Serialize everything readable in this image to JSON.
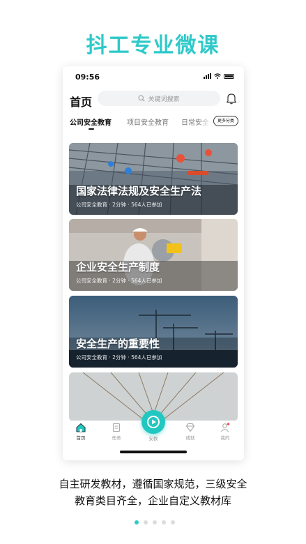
{
  "headline": "抖工专业微课",
  "status_bar": {
    "time": "09:56"
  },
  "header": {
    "title": "首页",
    "search_placeholder": "关键词搜索"
  },
  "tabs": [
    {
      "label": "公司安全教育",
      "active": true
    },
    {
      "label": "项目安全教育",
      "active": false
    },
    {
      "label": "日常安全",
      "active": false
    }
  ],
  "more_button": "更多分类",
  "courses": [
    {
      "title": "国家法律法规及安全生产法",
      "category": "公司安全教育",
      "duration": "2分钟",
      "participants": "564人已参加"
    },
    {
      "title": "企业安全生产制度",
      "category": "公司安全教育",
      "duration": "2分钟",
      "participants": "564人已参加"
    },
    {
      "title": "安全生产的重要性",
      "category": "公司安全教育",
      "duration": "2分钟",
      "participants": "564人已参加"
    }
  ],
  "tabbar": [
    {
      "label": "首页",
      "icon": "home-icon",
      "active": true
    },
    {
      "label": "任务",
      "icon": "task-icon",
      "active": false
    },
    {
      "label": "安教",
      "icon": "play-icon",
      "active": false
    },
    {
      "label": "成就",
      "icon": "diamond-icon",
      "active": false
    },
    {
      "label": "我的",
      "icon": "profile-icon",
      "active": false
    }
  ],
  "caption": {
    "line1": "自主研发教材，遵循国家规范，三级安全",
    "line2": "教育类目齐全，企业自定义教材库"
  },
  "pagination": {
    "current": 1,
    "total": 5
  },
  "colors": {
    "accent": "#2fc9c9",
    "center_button": "#21c7c0",
    "badge": "#ff4d4f"
  }
}
